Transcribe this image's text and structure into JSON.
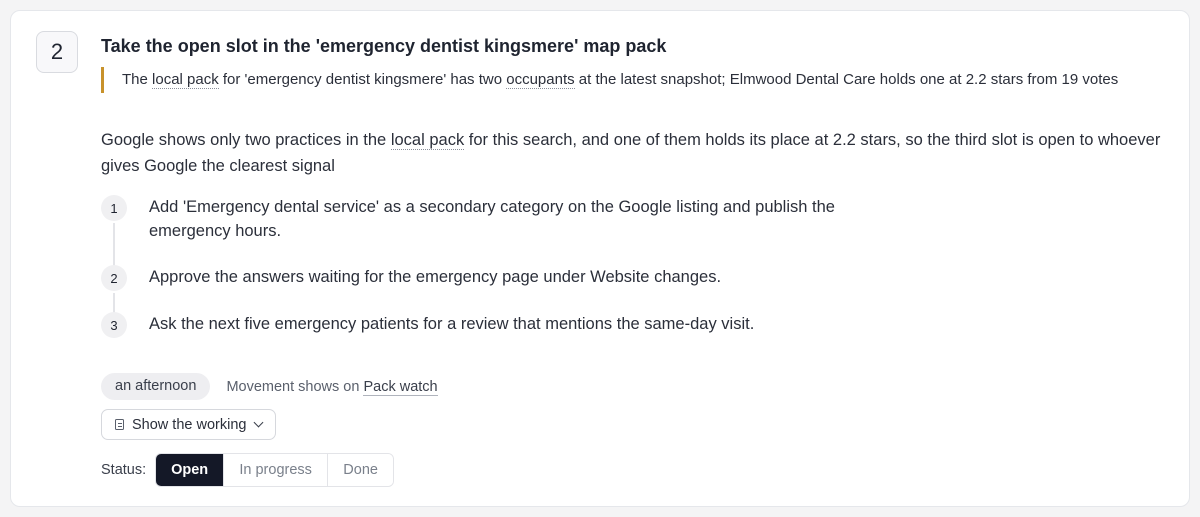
{
  "card": {
    "number": "2",
    "title": "Take the open slot in the 'emergency dentist kingsmere' map pack",
    "quote": {
      "part1": "The ",
      "term1": "local pack",
      "part2": " for 'emergency dentist kingsmere' has two ",
      "term2": "occupants",
      "part3": " at the latest snapshot; Elmwood Dental Care holds one at 2.2 stars from 19 votes"
    },
    "summary": {
      "part1": "Google shows only two practices in the ",
      "term1": "local pack",
      "part2": " for this search, and one of them holds its place at 2.2 stars, so the third slot is open to whoever gives Google the clearest signal"
    },
    "steps": [
      {
        "number": "1",
        "text": "Add 'Emergency dental service' as a secondary category on the Google listing and publish the emergency hours."
      },
      {
        "number": "2",
        "text": "Approve the answers waiting for the emergency page under Website changes."
      },
      {
        "number": "3",
        "text": "Ask the next five emergency patients for a review that mentions the same-day visit."
      }
    ],
    "effort": "an afternoon",
    "movement_prefix": "Movement shows on ",
    "movement_link": "Pack watch",
    "working_button": "Show the working",
    "status": {
      "label": "Status:",
      "options": [
        "Open",
        "In progress",
        "Done"
      ],
      "selected": "Open"
    }
  },
  "colors": {
    "quote_border": "#c8922b",
    "active_status_bg": "#141827"
  }
}
